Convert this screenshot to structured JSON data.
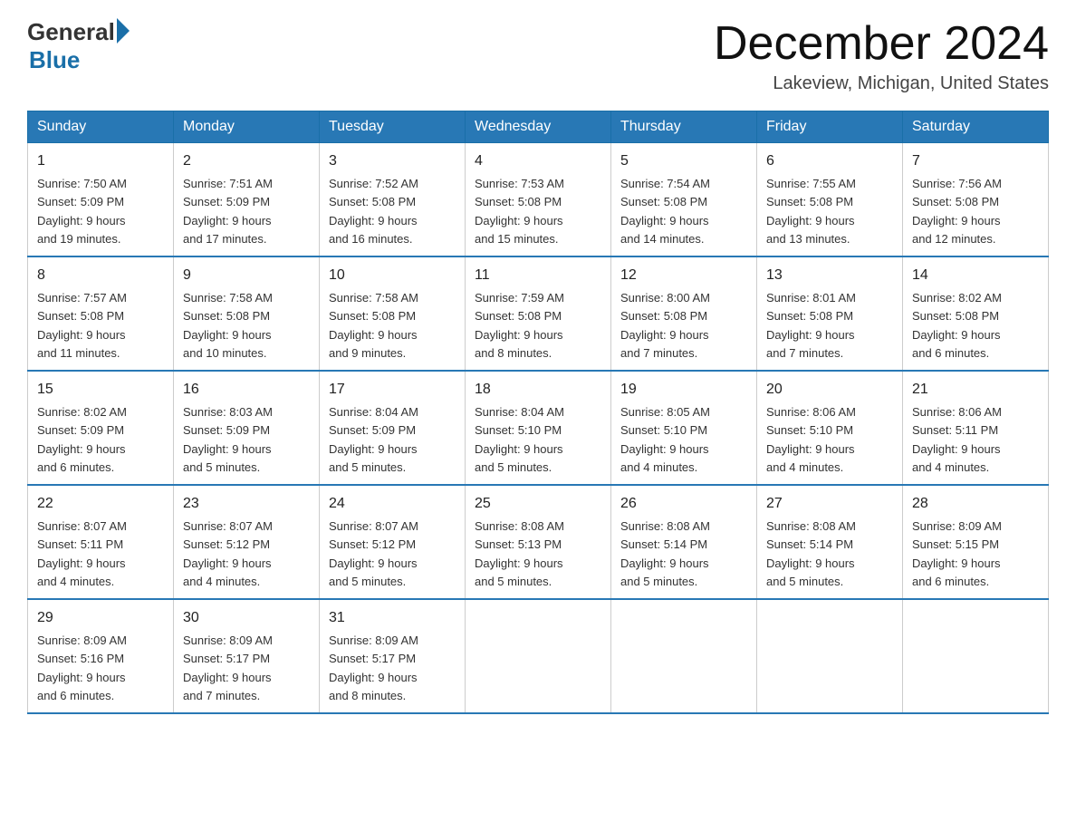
{
  "header": {
    "logo_general": "General",
    "logo_blue": "Blue",
    "month_title": "December 2024",
    "location": "Lakeview, Michigan, United States"
  },
  "days_of_week": [
    "Sunday",
    "Monday",
    "Tuesday",
    "Wednesday",
    "Thursday",
    "Friday",
    "Saturday"
  ],
  "weeks": [
    [
      {
        "day": "1",
        "sunrise": "7:50 AM",
        "sunset": "5:09 PM",
        "daylight": "9 hours and 19 minutes."
      },
      {
        "day": "2",
        "sunrise": "7:51 AM",
        "sunset": "5:09 PM",
        "daylight": "9 hours and 17 minutes."
      },
      {
        "day": "3",
        "sunrise": "7:52 AM",
        "sunset": "5:08 PM",
        "daylight": "9 hours and 16 minutes."
      },
      {
        "day": "4",
        "sunrise": "7:53 AM",
        "sunset": "5:08 PM",
        "daylight": "9 hours and 15 minutes."
      },
      {
        "day": "5",
        "sunrise": "7:54 AM",
        "sunset": "5:08 PM",
        "daylight": "9 hours and 14 minutes."
      },
      {
        "day": "6",
        "sunrise": "7:55 AM",
        "sunset": "5:08 PM",
        "daylight": "9 hours and 13 minutes."
      },
      {
        "day": "7",
        "sunrise": "7:56 AM",
        "sunset": "5:08 PM",
        "daylight": "9 hours and 12 minutes."
      }
    ],
    [
      {
        "day": "8",
        "sunrise": "7:57 AM",
        "sunset": "5:08 PM",
        "daylight": "9 hours and 11 minutes."
      },
      {
        "day": "9",
        "sunrise": "7:58 AM",
        "sunset": "5:08 PM",
        "daylight": "9 hours and 10 minutes."
      },
      {
        "day": "10",
        "sunrise": "7:58 AM",
        "sunset": "5:08 PM",
        "daylight": "9 hours and 9 minutes."
      },
      {
        "day": "11",
        "sunrise": "7:59 AM",
        "sunset": "5:08 PM",
        "daylight": "9 hours and 8 minutes."
      },
      {
        "day": "12",
        "sunrise": "8:00 AM",
        "sunset": "5:08 PM",
        "daylight": "9 hours and 7 minutes."
      },
      {
        "day": "13",
        "sunrise": "8:01 AM",
        "sunset": "5:08 PM",
        "daylight": "9 hours and 7 minutes."
      },
      {
        "day": "14",
        "sunrise": "8:02 AM",
        "sunset": "5:08 PM",
        "daylight": "9 hours and 6 minutes."
      }
    ],
    [
      {
        "day": "15",
        "sunrise": "8:02 AM",
        "sunset": "5:09 PM",
        "daylight": "9 hours and 6 minutes."
      },
      {
        "day": "16",
        "sunrise": "8:03 AM",
        "sunset": "5:09 PM",
        "daylight": "9 hours and 5 minutes."
      },
      {
        "day": "17",
        "sunrise": "8:04 AM",
        "sunset": "5:09 PM",
        "daylight": "9 hours and 5 minutes."
      },
      {
        "day": "18",
        "sunrise": "8:04 AM",
        "sunset": "5:10 PM",
        "daylight": "9 hours and 5 minutes."
      },
      {
        "day": "19",
        "sunrise": "8:05 AM",
        "sunset": "5:10 PM",
        "daylight": "9 hours and 4 minutes."
      },
      {
        "day": "20",
        "sunrise": "8:06 AM",
        "sunset": "5:10 PM",
        "daylight": "9 hours and 4 minutes."
      },
      {
        "day": "21",
        "sunrise": "8:06 AM",
        "sunset": "5:11 PM",
        "daylight": "9 hours and 4 minutes."
      }
    ],
    [
      {
        "day": "22",
        "sunrise": "8:07 AM",
        "sunset": "5:11 PM",
        "daylight": "9 hours and 4 minutes."
      },
      {
        "day": "23",
        "sunrise": "8:07 AM",
        "sunset": "5:12 PM",
        "daylight": "9 hours and 4 minutes."
      },
      {
        "day": "24",
        "sunrise": "8:07 AM",
        "sunset": "5:12 PM",
        "daylight": "9 hours and 5 minutes."
      },
      {
        "day": "25",
        "sunrise": "8:08 AM",
        "sunset": "5:13 PM",
        "daylight": "9 hours and 5 minutes."
      },
      {
        "day": "26",
        "sunrise": "8:08 AM",
        "sunset": "5:14 PM",
        "daylight": "9 hours and 5 minutes."
      },
      {
        "day": "27",
        "sunrise": "8:08 AM",
        "sunset": "5:14 PM",
        "daylight": "9 hours and 5 minutes."
      },
      {
        "day": "28",
        "sunrise": "8:09 AM",
        "sunset": "5:15 PM",
        "daylight": "9 hours and 6 minutes."
      }
    ],
    [
      {
        "day": "29",
        "sunrise": "8:09 AM",
        "sunset": "5:16 PM",
        "daylight": "9 hours and 6 minutes."
      },
      {
        "day": "30",
        "sunrise": "8:09 AM",
        "sunset": "5:17 PM",
        "daylight": "9 hours and 7 minutes."
      },
      {
        "day": "31",
        "sunrise": "8:09 AM",
        "sunset": "5:17 PM",
        "daylight": "9 hours and 8 minutes."
      },
      null,
      null,
      null,
      null
    ]
  ]
}
